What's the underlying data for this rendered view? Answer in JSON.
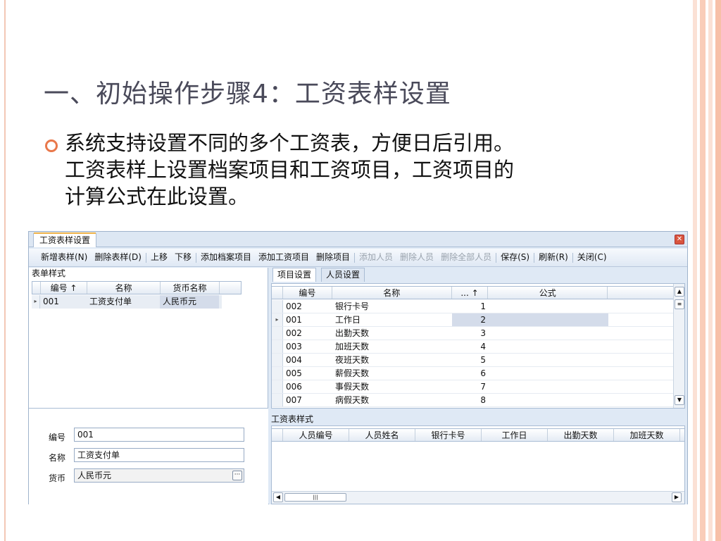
{
  "slide": {
    "title": "一、初始操作步骤4：工资表样设置",
    "body_lines": [
      "系统支持设置不同的多个工资表，方便日后引用。",
      "工资表样上设置档案项目和工资项目，工资项目的",
      "计算公式在此设置。"
    ]
  },
  "colors": {
    "accent": "#e9784b",
    "title": "#4a4a5a",
    "window_bg": "#dfe9f5",
    "selected_row": "#d4dcea"
  },
  "app": {
    "doc_tab": "工资表样设置",
    "toolbar": [
      {
        "label": "新增表样(N)",
        "disabled": false
      },
      {
        "label": "删除表样(D)",
        "disabled": false
      },
      {
        "label": "上移",
        "disabled": false
      },
      {
        "label": "下移",
        "disabled": false
      },
      {
        "label": "添加档案项目",
        "disabled": false
      },
      {
        "label": "添加工资项目",
        "disabled": false
      },
      {
        "label": "删除项目",
        "disabled": false
      },
      {
        "label": "添加人员",
        "disabled": true
      },
      {
        "label": "删除人员",
        "disabled": true
      },
      {
        "label": "删除全部人员",
        "disabled": true
      },
      {
        "label": "保存(S)",
        "disabled": false
      },
      {
        "label": "刷新(R)",
        "disabled": false
      },
      {
        "label": "关闭(C)",
        "disabled": false
      }
    ],
    "left": {
      "label": "表单样式",
      "columns": [
        "编号 ↑",
        "名称",
        "货币名称"
      ],
      "rows": [
        [
          "001",
          "工资支付单",
          "人民币元"
        ]
      ],
      "form": {
        "code_label": "编号",
        "code_value": "001",
        "name_label": "名称",
        "name_value": "工资支付单",
        "currency_label": "货币",
        "currency_value": "人民币元"
      }
    },
    "right": {
      "tabs": [
        "项目设置",
        "人员设置"
      ],
      "columns": [
        "编号",
        "名称",
        "... ↑",
        "公式"
      ],
      "rows": [
        [
          "002",
          "银行卡号",
          "1",
          ""
        ],
        [
          "001",
          "工作日",
          "2",
          ""
        ],
        [
          "002",
          "出勤天数",
          "3",
          ""
        ],
        [
          "003",
          "加班天数",
          "4",
          ""
        ],
        [
          "004",
          "夜班天数",
          "5",
          ""
        ],
        [
          "005",
          "薪假天数",
          "6",
          ""
        ],
        [
          "006",
          "事假天数",
          "7",
          ""
        ],
        [
          "007",
          "病假天数",
          "8",
          ""
        ]
      ],
      "selected_row": 1,
      "lower_label": "工资表样式",
      "lower_columns": [
        "人员编号",
        "人员姓名",
        "银行卡号",
        "工作日",
        "出勤天数",
        "加班天数"
      ]
    }
  }
}
